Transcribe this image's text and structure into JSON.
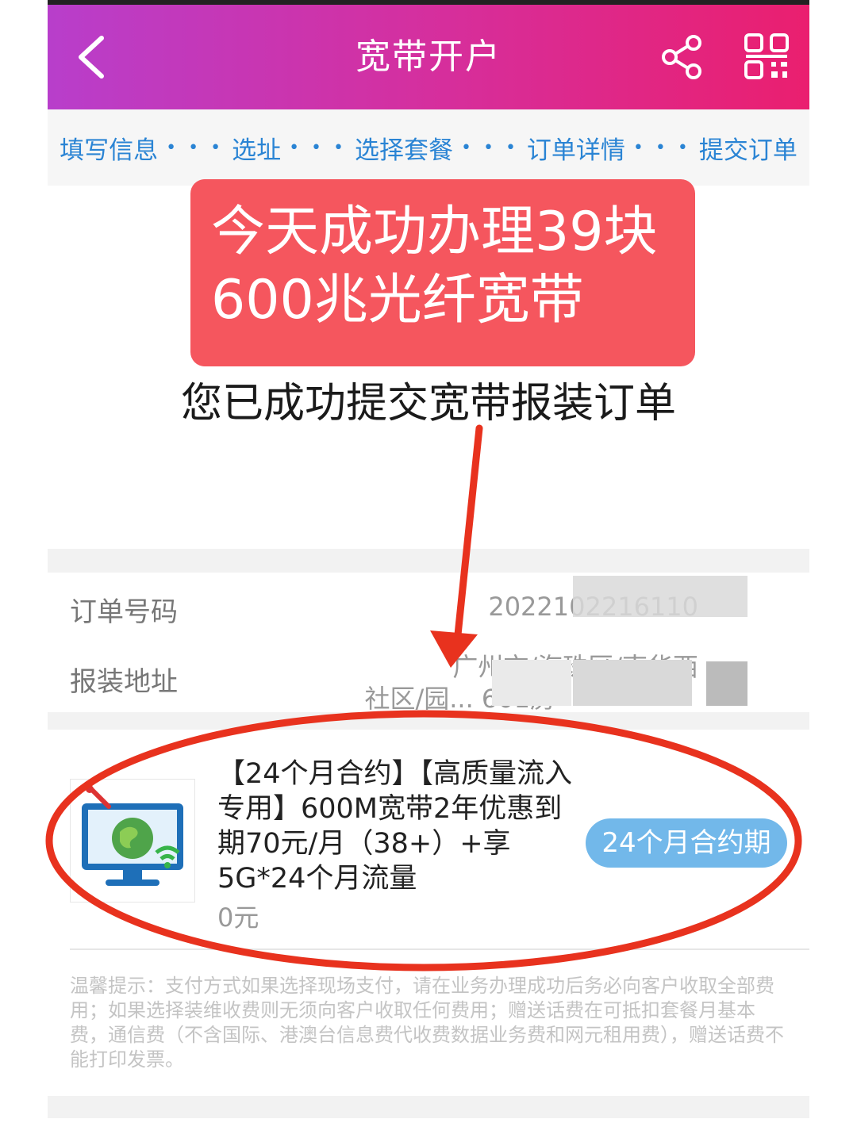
{
  "header": {
    "title": "宽带开户"
  },
  "steps": [
    "填写信息",
    "选址",
    "选择套餐",
    "订单详情",
    "提交订单"
  ],
  "steps_separator": "• • •",
  "promo": {
    "line1": "今天成功办理39块",
    "line2": "600兆光纤宽带"
  },
  "success_message": "您已成功提交宽带报装订单",
  "order": {
    "number_label": "订单号码",
    "number_value": "2022102216110",
    "address_label": "报装地址",
    "address_line1": "广州市/海珠区/南华西",
    "address_line2": "社区/园... 601房"
  },
  "package": {
    "name": "【24个月合约】【高质量流入专用】600M宽带2年优惠到期70元/月（38+）+享5G*24个月流量",
    "price": "0元",
    "contract_badge": "24个月合约期"
  },
  "tip": "温馨提示：支付方式如果选择现场支付，请在业务办理成功后务必向客户收取全部费用；如果选择装维收费则无须向客户收取任何费用；赠送话费在可抵扣套餐月基本费，通信费（不含国际、港澳台信息费代收费数据业务费和网元租用费），赠送话费不能打印发票。",
  "colors": {
    "header_gradient_start": "#b83ecb",
    "header_gradient_end": "#ea1f6f",
    "steps_text": "#2a84d4",
    "promo_bg": "#f5565e",
    "badge_bg": "#72b8ea",
    "annotation_red": "#e8321e"
  },
  "icons": {
    "back": "chevron-left-icon",
    "share": "share-icon",
    "qr": "qr-code-icon",
    "package": "computer-globe-icon"
  }
}
